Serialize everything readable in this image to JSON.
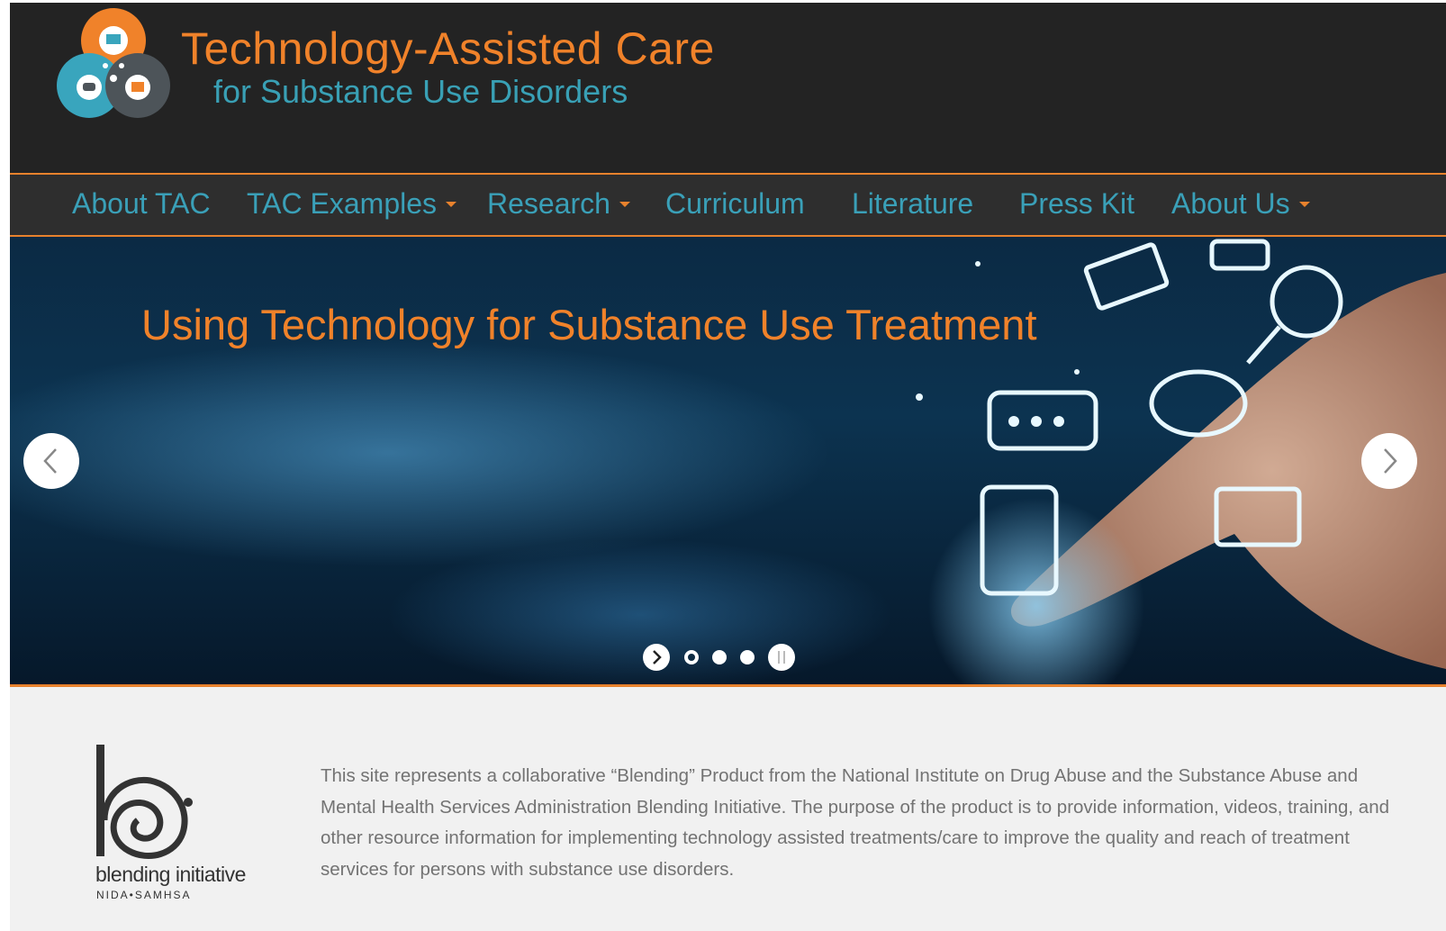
{
  "header": {
    "logo_title": "Technology-Assisted Care",
    "logo_subtitle": "for Substance Use Disorders"
  },
  "nav": {
    "items": [
      {
        "label": "About TAC",
        "dropdown": false
      },
      {
        "label": "TAC Examples",
        "dropdown": true
      },
      {
        "label": "Research",
        "dropdown": true
      },
      {
        "label": "Curriculum",
        "dropdown": false
      },
      {
        "label": "Literature",
        "dropdown": false
      },
      {
        "label": "Press Kit",
        "dropdown": false
      },
      {
        "label": "About Us",
        "dropdown": true
      }
    ]
  },
  "hero": {
    "title": "Using Technology for Substance Use Treatment",
    "active_slide": 1,
    "slide_count": 3
  },
  "footer": {
    "logo_text": "blending initiative",
    "logo_subtext": "NIDA•SAMHSA",
    "description": "This site represents a collaborative “Blending” Product from the National Institute on Drug Abuse and the Substance Abuse and Mental Health Services Administration Blending Initiative. The purpose of the product is to provide information, videos, training, and other resource information for  implementing technology assisted treatments/care to improve the quality and reach of treatment services for persons with substance use disorders."
  },
  "colors": {
    "accent_orange": "#f0822a",
    "accent_teal": "#3aa0b8",
    "header_bg": "#232323",
    "nav_bg": "#2e2e2e"
  }
}
